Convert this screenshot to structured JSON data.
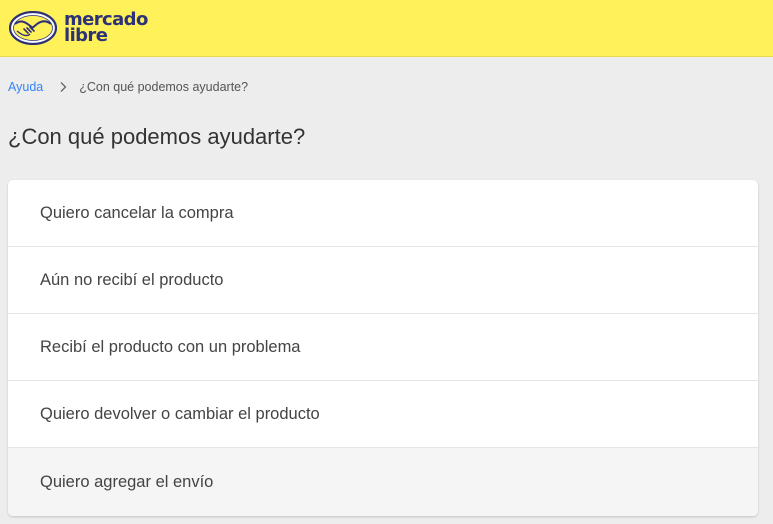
{
  "brand": {
    "name_line1": "mercado",
    "name_line2": "libre",
    "logo_icon": "handshake-icon",
    "colors": {
      "header": "#fff159",
      "logo_text": "#2d3277",
      "link": "#3483fa"
    }
  },
  "breadcrumb": {
    "root": "Ayuda",
    "separator_icon": "chevron-right-icon",
    "current": "¿Con qué podemos ayudarte?"
  },
  "page": {
    "title": "¿Con qué podemos ayudarte?"
  },
  "help_options": [
    {
      "label": "Quiero cancelar la compra"
    },
    {
      "label": "Aún no recibí el producto"
    },
    {
      "label": "Recibí el producto con un problema"
    },
    {
      "label": "Quiero devolver o cambiar el producto"
    },
    {
      "label": "Quiero agregar el envío"
    }
  ]
}
